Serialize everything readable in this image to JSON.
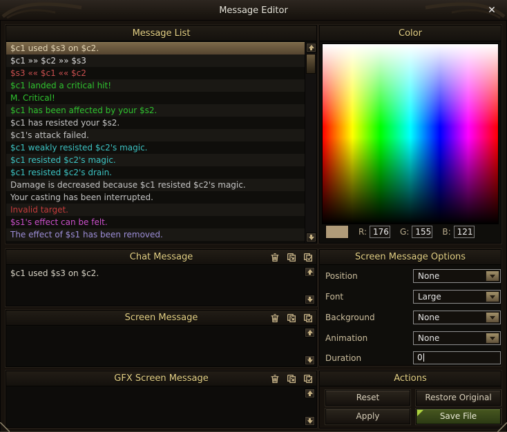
{
  "window": {
    "title": "Message Editor",
    "close_icon": "✕"
  },
  "message_list": {
    "title": "Message List",
    "items": [
      {
        "text": "$c1 used $s3 on $c2.",
        "color": "#e3d5b4",
        "selected": true
      },
      {
        "text": "$c1  »»  $c2  »»  $s3",
        "color": "#d8d8d8"
      },
      {
        "text": "$s3  ««  $c1  ««  $c2",
        "color": "#c94f4f"
      },
      {
        "text": "$c1 landed a critical hit!",
        "color": "#2fc32f"
      },
      {
        "text": "M. Critical!",
        "color": "#2fc32f"
      },
      {
        "text": "$c1 has been affected by your $s2.",
        "color": "#2fc32f"
      },
      {
        "text": "$c1 has resisted your $s2.",
        "color": "#c4c4c4"
      },
      {
        "text": "$c1's attack failed.",
        "color": "#c4c4c4"
      },
      {
        "text": "$c1 weakly resisted $c2's magic.",
        "color": "#3cc3c3"
      },
      {
        "text": "$c1 resisted $c2's magic.",
        "color": "#3cc3c3"
      },
      {
        "text": "$c1 resisted $c2's drain.",
        "color": "#3cc3c3"
      },
      {
        "text": "Damage is decreased because $c1 resisted $c2's magic.",
        "color": "#c4c4c4"
      },
      {
        "text": "Your casting has been interrupted.",
        "color": "#c4c4c4"
      },
      {
        "text": "Invalid target.",
        "color": "#c43b3b"
      },
      {
        "text": "$s1's effect can be felt.",
        "color": "#cb4fcb"
      },
      {
        "text": "The effect of $s1 has been removed.",
        "color": "#9d8ed8"
      }
    ]
  },
  "color_panel": {
    "title": "Color",
    "swatch_color": "#b09b79",
    "r_label": "R:",
    "r_value": "176",
    "g_label": "G:",
    "g_value": "155",
    "b_label": "B:",
    "b_value": "121"
  },
  "chat_message": {
    "title": "Chat Message",
    "content": "$c1 used $s3 on $c2."
  },
  "screen_message": {
    "title": "Screen Message",
    "content": ""
  },
  "gfx_screen_message": {
    "title": "GFX Screen Message",
    "content": ""
  },
  "header_icons": [
    {
      "name": "trash-icon"
    },
    {
      "name": "paste-icon"
    },
    {
      "name": "check-icon"
    }
  ],
  "options": {
    "title": "Screen Message Options",
    "fields": [
      {
        "label": "Position",
        "value": "None",
        "type": "dropdown"
      },
      {
        "label": "Font",
        "value": "Large",
        "type": "dropdown"
      },
      {
        "label": "Background",
        "value": "None",
        "type": "dropdown"
      },
      {
        "label": "Animation",
        "value": "None",
        "type": "dropdown"
      },
      {
        "label": "Duration",
        "value": "0",
        "type": "input"
      }
    ]
  },
  "actions": {
    "title": "Actions",
    "buttons": [
      {
        "label": "Reset"
      },
      {
        "label": "Restore Original"
      },
      {
        "label": "Apply"
      },
      {
        "label": "Save File",
        "highlight": true
      }
    ]
  }
}
